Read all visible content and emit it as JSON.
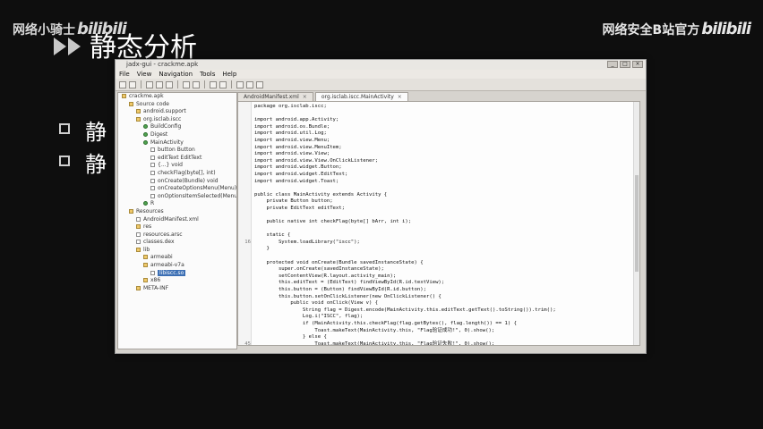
{
  "watermark": {
    "left_text": "网络小骑士",
    "left_logo": "bilibili",
    "right_text": "网络安全B站官方",
    "right_logo": "bilibili"
  },
  "slide": {
    "title": "静态分析",
    "bullets": [
      "静",
      "静"
    ]
  },
  "window": {
    "title": "jadx-gui - crackme.apk",
    "menu": [
      "File",
      "View",
      "Navigation",
      "Tools",
      "Help"
    ],
    "tree": [
      {
        "label": "crackme.apk",
        "indent": 0,
        "icon": "pkg"
      },
      {
        "label": "Source code",
        "indent": 1,
        "icon": "pkg"
      },
      {
        "label": "android.support",
        "indent": 2,
        "icon": "pkg"
      },
      {
        "label": "org.isclab.iscc",
        "indent": 2,
        "icon": "pkg"
      },
      {
        "label": "BuildConfig",
        "indent": 3,
        "icon": "cls"
      },
      {
        "label": "Digest",
        "indent": 3,
        "icon": "cls"
      },
      {
        "label": "MainActivity",
        "indent": 3,
        "icon": "cls"
      },
      {
        "label": "button  Button",
        "indent": 4,
        "icon": "f"
      },
      {
        "label": "editText  EditText",
        "indent": 4,
        "icon": "f"
      },
      {
        "label": "{...}  void",
        "indent": 4,
        "icon": "f"
      },
      {
        "label": "checkFlag(byte[], int)",
        "indent": 4,
        "icon": "m"
      },
      {
        "label": "onCreate(Bundle)  void",
        "indent": 4,
        "icon": "m"
      },
      {
        "label": "onCreateOptionsMenu(Menu)",
        "indent": 4,
        "icon": "m"
      },
      {
        "label": "onOptionsItemSelected(MenuItem)",
        "indent": 4,
        "icon": "m"
      },
      {
        "label": "R",
        "indent": 3,
        "icon": "cls"
      },
      {
        "label": "Resources",
        "indent": 1,
        "icon": "pkg"
      },
      {
        "label": "AndroidManifest.xml",
        "indent": 2,
        "icon": "f"
      },
      {
        "label": "res",
        "indent": 2,
        "icon": "pkg"
      },
      {
        "label": "resources.arsc",
        "indent": 2,
        "icon": "f"
      },
      {
        "label": "classes.dex",
        "indent": 2,
        "icon": "f"
      },
      {
        "label": "lib",
        "indent": 2,
        "icon": "pkg"
      },
      {
        "label": "armeabi",
        "indent": 3,
        "icon": "pkg"
      },
      {
        "label": "armeabi-v7a",
        "indent": 3,
        "icon": "pkg"
      },
      {
        "label": "libiscc.so",
        "indent": 4,
        "icon": "f",
        "selected": true
      },
      {
        "label": "x86",
        "indent": 3,
        "icon": "pkg"
      },
      {
        "label": "META-INF",
        "indent": 2,
        "icon": "pkg"
      }
    ],
    "tabs": [
      {
        "label": "AndroidManifest.xml",
        "active": false
      },
      {
        "label": "org.isclab.iscc.MainActivity",
        "active": true
      }
    ],
    "code": [
      {
        "n": "",
        "t": "package org.isclab.iscc;"
      },
      {
        "n": "",
        "t": ""
      },
      {
        "n": "",
        "t": "import android.app.Activity;"
      },
      {
        "n": "",
        "t": "import android.os.Bundle;"
      },
      {
        "n": "",
        "t": "import android.util.Log;"
      },
      {
        "n": "",
        "t": "import android.view.Menu;"
      },
      {
        "n": "",
        "t": "import android.view.MenuItem;"
      },
      {
        "n": "",
        "t": "import android.view.View;"
      },
      {
        "n": "",
        "t": "import android.view.View.OnClickListener;"
      },
      {
        "n": "",
        "t": "import android.widget.Button;"
      },
      {
        "n": "",
        "t": "import android.widget.EditText;"
      },
      {
        "n": "",
        "t": "import android.widget.Toast;"
      },
      {
        "n": "",
        "t": ""
      },
      {
        "n": "",
        "t": "public class MainActivity extends Activity {"
      },
      {
        "n": "",
        "t": "    private Button button;"
      },
      {
        "n": "",
        "t": "    private EditText editText;"
      },
      {
        "n": "",
        "t": ""
      },
      {
        "n": "",
        "t": "    public native int checkFlag(byte[] bArr, int i);"
      },
      {
        "n": "",
        "t": ""
      },
      {
        "n": "",
        "t": "    static {"
      },
      {
        "n": "16",
        "t": "        System.loadLibrary(\"iscc\");"
      },
      {
        "n": "",
        "t": "    }"
      },
      {
        "n": "",
        "t": ""
      },
      {
        "n": "",
        "t": "    protected void onCreate(Bundle savedInstanceState) {"
      },
      {
        "n": "",
        "t": "        super.onCreate(savedInstanceState);"
      },
      {
        "n": "",
        "t": "        setContentView(R.layout.activity_main);"
      },
      {
        "n": "",
        "t": "        this.editText = (EditText) findViewById(R.id.textView);"
      },
      {
        "n": "",
        "t": "        this.button = (Button) findViewById(R.id.button);"
      },
      {
        "n": "",
        "t": "        this.button.setOnClickListener(new OnClickListener() {"
      },
      {
        "n": "",
        "t": "            public void onClick(View v) {"
      },
      {
        "n": "",
        "t": "                String flag = Digest.encode(MainActivity.this.editText.getText().toString()).trim();"
      },
      {
        "n": "",
        "t": "                Log.i(\"ISCC\", flag);"
      },
      {
        "n": "",
        "t": "                if (MainActivity.this.checkFlag(flag.getBytes(), flag.length()) == 1) {"
      },
      {
        "n": "",
        "t": "                    Toast.makeText(MainActivity.this, \"Flag验证成功!\", 0).show();"
      },
      {
        "n": "",
        "t": "                } else {"
      },
      {
        "n": "45",
        "t": "                    Toast.makeText(MainActivity.this, \"Flag验证失败!\", 0).show();"
      },
      {
        "n": "",
        "t": "                }"
      },
      {
        "n": "",
        "t": "            }"
      },
      {
        "n": "",
        "t": "        });"
      },
      {
        "n": "",
        "t": "    }"
      }
    ]
  }
}
